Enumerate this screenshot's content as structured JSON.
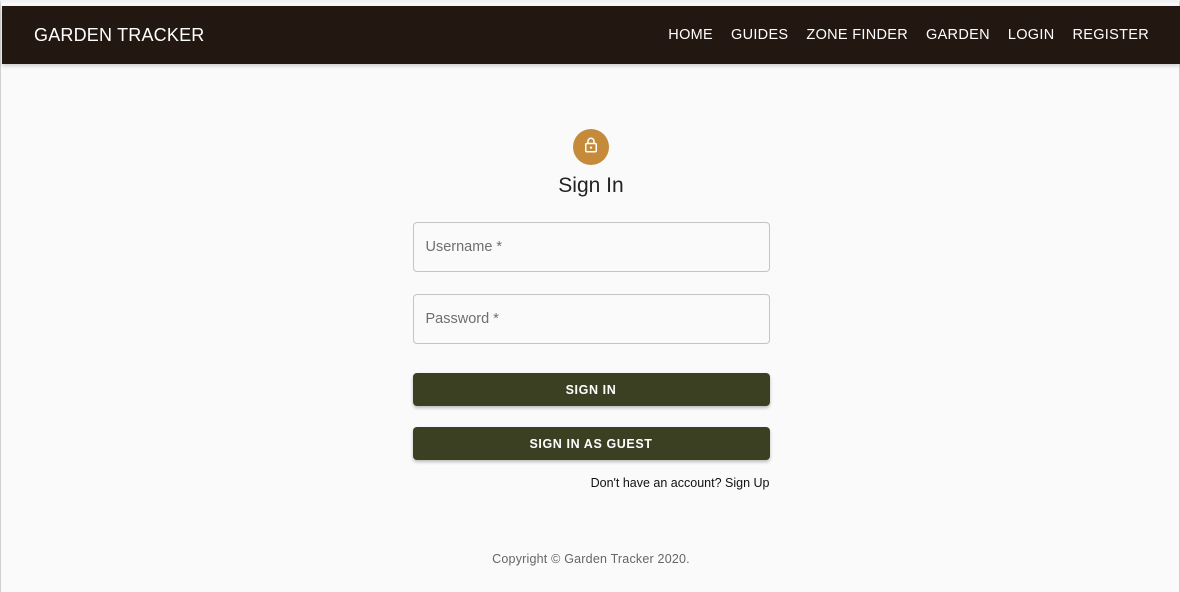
{
  "navbar": {
    "brand": "GARDEN TRACKER",
    "links": [
      {
        "label": "HOME"
      },
      {
        "label": "GUIDES"
      },
      {
        "label": "ZONE FINDER"
      },
      {
        "label": "GARDEN"
      },
      {
        "label": "LOGIN"
      },
      {
        "label": "REGISTER"
      }
    ]
  },
  "form": {
    "icon": "lock-icon",
    "title": "Sign In",
    "username": {
      "placeholder": "Username *",
      "value": ""
    },
    "password": {
      "placeholder": "Password *",
      "value": ""
    },
    "signin_label": "SIGN IN",
    "guest_label": "SIGN IN AS GUEST",
    "signup_text": "Don't have an account? Sign Up"
  },
  "footer": {
    "copyright": "Copyright © Garden Tracker 2020."
  },
  "colors": {
    "navbar_bg": "#231811",
    "accent_avatar": "#c58a3a",
    "button_bg": "#3b4022",
    "page_bg": "#fafafa"
  }
}
